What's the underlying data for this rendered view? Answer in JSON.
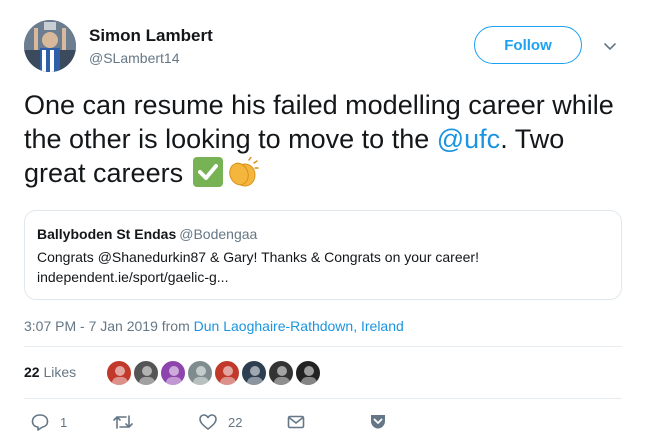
{
  "tweet": {
    "author_name": "Simon Lambert",
    "author_handle": "@SLambert14",
    "follow_label": "Follow",
    "text_part1": "One can resume his failed modelling career while the other is looking to move to the ",
    "mention": "@ufc",
    "text_part2": ". Two great careers",
    "emojis": [
      "white-check-mark",
      "clapping-hands"
    ]
  },
  "quote": {
    "name": "Ballyboden St Endas",
    "handle": "@Bodengaa",
    "line1": "Congrats @Shanedurkin87 & Gary! Thanks & Congrats on your career!",
    "line2": "independent.ie/sport/gaelic-g..."
  },
  "meta": {
    "time": "3:07 PM - 7 Jan 2019 from",
    "location": "Dun Laoghaire-Rathdown, Ireland"
  },
  "likes": {
    "count": "22",
    "label": "Likes",
    "avatar_colors": [
      "#c0392b",
      "#555555",
      "#8e44ad",
      "#7f8c8d",
      "#c0392b",
      "#2c3e50",
      "#333333",
      "#222222"
    ]
  },
  "actions": {
    "reply_count": "1",
    "retweet_count": "",
    "like_count": "22"
  },
  "colors": {
    "accent": "#1da1f2",
    "link": "#1b95e0",
    "muted": "#657786"
  }
}
